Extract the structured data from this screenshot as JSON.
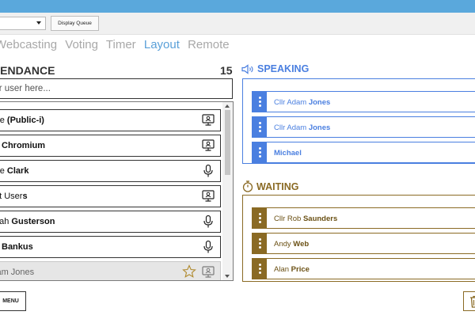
{
  "toolbar": {
    "select_value": "",
    "display_queue_label": "Display Queue"
  },
  "tabs": [
    {
      "label": "Webcasting",
      "active": false
    },
    {
      "label": "Voting",
      "active": false
    },
    {
      "label": "Timer",
      "active": false
    },
    {
      "label": "Layout",
      "active": true
    },
    {
      "label": "Remote",
      "active": false
    }
  ],
  "attendance": {
    "title": "ATTENDANCE",
    "count": "15",
    "search_placeholder": "Filter user here...",
    "rows": [
      {
        "name": "Jane",
        "bold": " (Public-i)",
        "icon": "monitor-icon"
      },
      {
        "name": "",
        "bold": "Chromium",
        "icon": "monitor-icon"
      },
      {
        "name": "Luke ",
        "bold": "Clark",
        "icon": "microphone-icon"
      },
      {
        "name": "Test User",
        "bold": "s",
        "icon": "monitor-icon"
      },
      {
        "name": "Sarah ",
        "bold": "Gusterson",
        "icon": "microphone-icon"
      },
      {
        "name": "",
        "bold": "Bankus",
        "icon": "microphone-icon"
      },
      {
        "name": "Adam ",
        "bold": "Jones",
        "icon": "monitor-icon"
      }
    ]
  },
  "speaking": {
    "title": "SPEAKING",
    "items": [
      {
        "prefix": "Cllr Adam ",
        "bold": "Jones"
      },
      {
        "prefix": "Cllr Adam ",
        "bold": "Jones"
      },
      {
        "prefix": "",
        "bold": "Michael"
      }
    ]
  },
  "waiting": {
    "title": "WAITING",
    "items": [
      {
        "prefix": "Cllr Rob ",
        "bold": "Saunders"
      },
      {
        "prefix": "Andy ",
        "bold": "Web"
      },
      {
        "prefix": "Alan ",
        "bold": "Price"
      }
    ]
  },
  "footer": {
    "menu_label": "MENU"
  },
  "colors": {
    "topbar": "#5aa8dc",
    "tab_active": "#5aa0d8",
    "speaking": "#4a7fe0",
    "waiting": "#8a6a24"
  }
}
